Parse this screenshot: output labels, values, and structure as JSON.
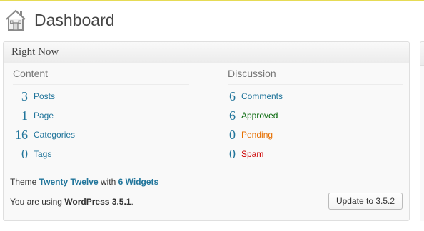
{
  "page": {
    "title": "Dashboard",
    "icon": "home-icon"
  },
  "colors": {
    "link": "#21759b",
    "approved": "#006505",
    "pending": "#e66f00",
    "spam": "#cc0000",
    "notice_border": "#e6db55"
  },
  "right_now": {
    "title": "Right Now",
    "content": {
      "heading": "Content",
      "rows": [
        {
          "count": "3",
          "label": "Posts"
        },
        {
          "count": "1",
          "label": "Page"
        },
        {
          "count": "16",
          "label": "Categories"
        },
        {
          "count": "0",
          "label": "Tags"
        }
      ]
    },
    "discussion": {
      "heading": "Discussion",
      "rows": [
        {
          "count": "6",
          "label": "Comments"
        },
        {
          "count": "6",
          "label": "Approved"
        },
        {
          "count": "0",
          "label": "Pending"
        },
        {
          "count": "0",
          "label": "Spam"
        }
      ]
    },
    "theme": {
      "prefix": "Theme",
      "name": "Twenty Twelve",
      "middle": "with",
      "widgets": "6 Widgets"
    },
    "version": {
      "prefix": "You are using",
      "product": "WordPress 3.5.1",
      "suffix": ".",
      "update_button": "Update to 3.5.2"
    }
  }
}
